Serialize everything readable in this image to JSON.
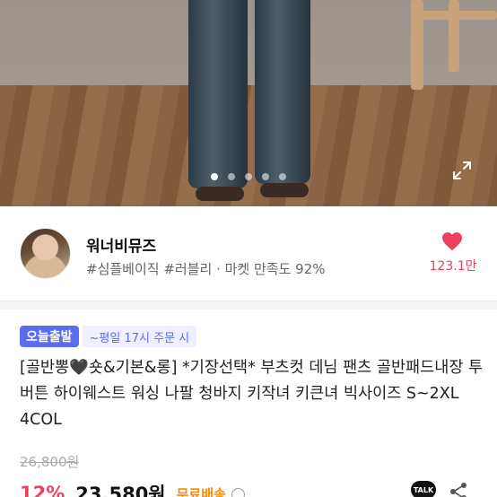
{
  "gallery": {
    "slide_count": 5,
    "active_slide": 1
  },
  "shop": {
    "name": "워너비뮤즈",
    "tags": "#심플베이직 #러블리 · 마켓 만족도 92%",
    "likes": "123.1만"
  },
  "product": {
    "badge": "오늘출발",
    "badge_sub": "~평일 17시 주문 시",
    "title": "[골반뽕🖤숏&기본&롱] *기장선택* 부츠컷 데님 팬츠 골반패드내장 투버튼 하이웨스트 워싱 나팔 청바지 키작녀 키큰녀 빅사이즈 S~2XL 4COL",
    "original_price": "26,800원",
    "discount": "12%",
    "price": "23,580원",
    "shipping": "무료배송",
    "talk_label": "TALK"
  },
  "colors": {
    "accent_pink": "#ee3f5c",
    "badge_blue": "#5b6cf0",
    "shipping_orange": "#ff8a00"
  },
  "icons": {
    "expand": "expand-icon",
    "heart": "heart-icon",
    "info": "info-icon",
    "talk": "talk-icon",
    "share": "share-icon"
  }
}
